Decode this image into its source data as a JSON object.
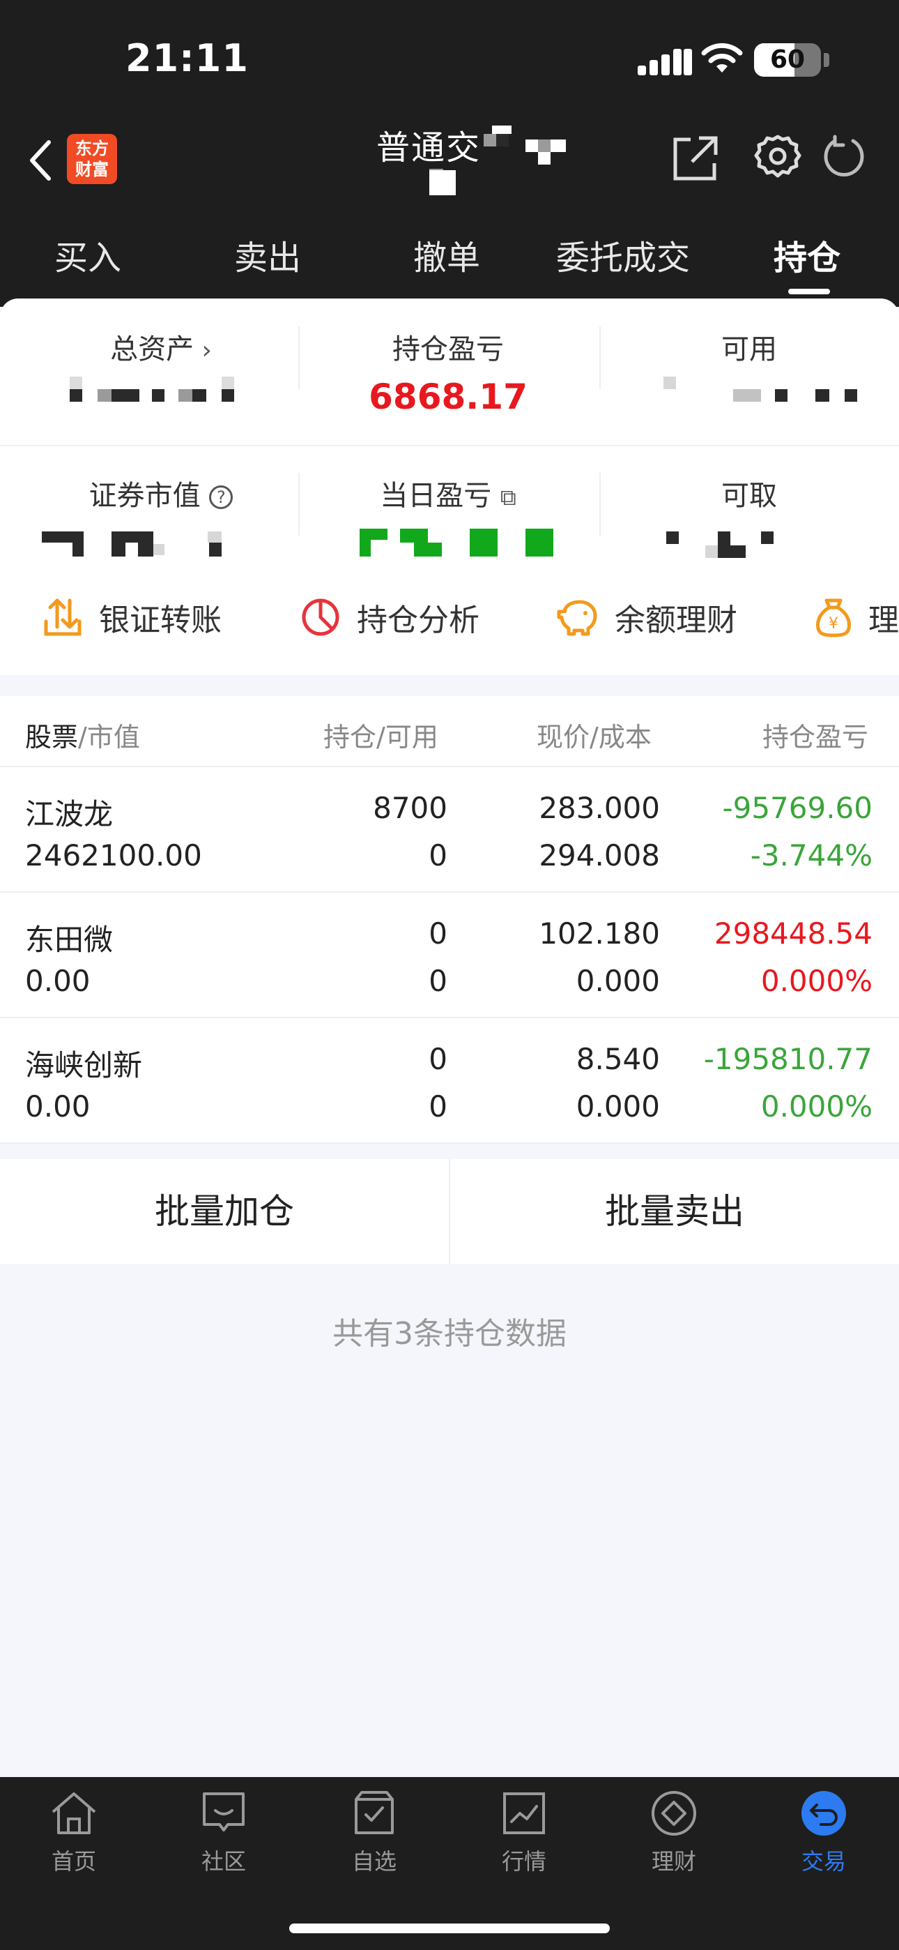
{
  "status_bar": {
    "time": "21:11",
    "battery": "60",
    "battery_level": 0.6
  },
  "nav": {
    "title": "普通交",
    "logo_text_line1": "东方",
    "logo_text_line2": "财富"
  },
  "tabs": [
    {
      "label": "买入"
    },
    {
      "label": "卖出"
    },
    {
      "label": "撤单"
    },
    {
      "label": "委托成交"
    },
    {
      "label": "持仓",
      "active": true
    }
  ],
  "summary": {
    "total_assets_label": "总资产",
    "position_pnl_label": "持仓盈亏",
    "position_pnl_value": "6868.17",
    "available_label": "可用",
    "market_value_label": "证券市值",
    "daily_pnl_label": "当日盈亏",
    "withdrawable_label": "可取"
  },
  "quick_actions": [
    {
      "label": "银证转账",
      "icon": "transfer-icon"
    },
    {
      "label": "持仓分析",
      "icon": "pie-chart-icon"
    },
    {
      "label": "余额理财",
      "icon": "piggy-bank-icon"
    },
    {
      "label": "理财",
      "icon": "money-bag-icon"
    }
  ],
  "table": {
    "headers": {
      "stock": "股票",
      "market_value": "市值",
      "holding": "持仓",
      "available": "可用",
      "price": "现价",
      "cost": "成本",
      "pnl": "持仓盈亏"
    },
    "rows": [
      {
        "name": "江波龙",
        "market_value": "2462100.00",
        "holding": "8700",
        "available": "0",
        "price": "283.000",
        "cost": "294.008",
        "pnl": "-95769.60",
        "pnl_pct": "-3.744%"
      },
      {
        "name": "东田微",
        "market_value": "0.00",
        "holding": "0",
        "available": "0",
        "price": "102.180",
        "cost": "0.000",
        "pnl": "298448.54",
        "pnl_pct": "0.000%"
      },
      {
        "name": "海峡创新",
        "market_value": "0.00",
        "holding": "0",
        "available": "0",
        "price": "8.540",
        "cost": "0.000",
        "pnl": "-195810.77",
        "pnl_pct": "0.000%"
      }
    ]
  },
  "batch": {
    "add_label": "批量加仓",
    "sell_label": "批量卖出"
  },
  "footer_note": "共有3条持仓数据",
  "colors": {
    "profit": "#e8181f",
    "loss": "#3aa53a",
    "accent": "#2d7bf0",
    "header_bg": "#1e1e1e"
  },
  "tabbar": [
    {
      "label": "首页",
      "icon": "home-icon"
    },
    {
      "label": "社区",
      "icon": "chat-icon"
    },
    {
      "label": "自选",
      "icon": "bag-check-icon"
    },
    {
      "label": "行情",
      "icon": "chart-icon"
    },
    {
      "label": "理财",
      "icon": "diamond-icon"
    },
    {
      "label": "交易",
      "icon": "trade-icon",
      "active": true
    }
  ]
}
